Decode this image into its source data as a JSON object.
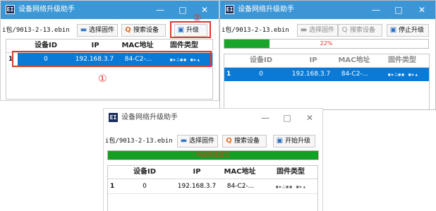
{
  "app": {
    "icon_glyph": "EI",
    "title": "设备网络升级助手",
    "window_controls": [
      "—",
      "□",
      "✕"
    ]
  },
  "toolbar": {
    "path": "i包/9013-2-13.ebin",
    "path_w3": "i包/9013-2-13.ebin",
    "select_firmware": "选择固件",
    "search_device": "搜索设备",
    "upgrade": "升级",
    "stop_upgrade": "停止升级",
    "start_upgrade": "开始升级"
  },
  "table": {
    "columns": [
      "设备ID",
      "IP",
      "MAC地址",
      "固件类型"
    ],
    "rows": [
      {
        "index": "1",
        "device_id": "0",
        "ip": "192.168.3.7",
        "mac": "84-C2-...",
        "firmware_type": "▪▸∴▪▪ ▪▸▴"
      }
    ]
  },
  "annotations": {
    "step1": "①",
    "step2": "②"
  },
  "progress_w2": {
    "value_percent": 22,
    "label": "22%"
  },
  "progress_w3": {
    "value_percent": 100,
    "label": "升级完成成功"
  },
  "colors": {
    "titlebar_blue": "#3b97d6",
    "selection_blue": "#0a7ad6",
    "progress_green": "#19a52a",
    "annotation_red": "#e23a2a"
  }
}
